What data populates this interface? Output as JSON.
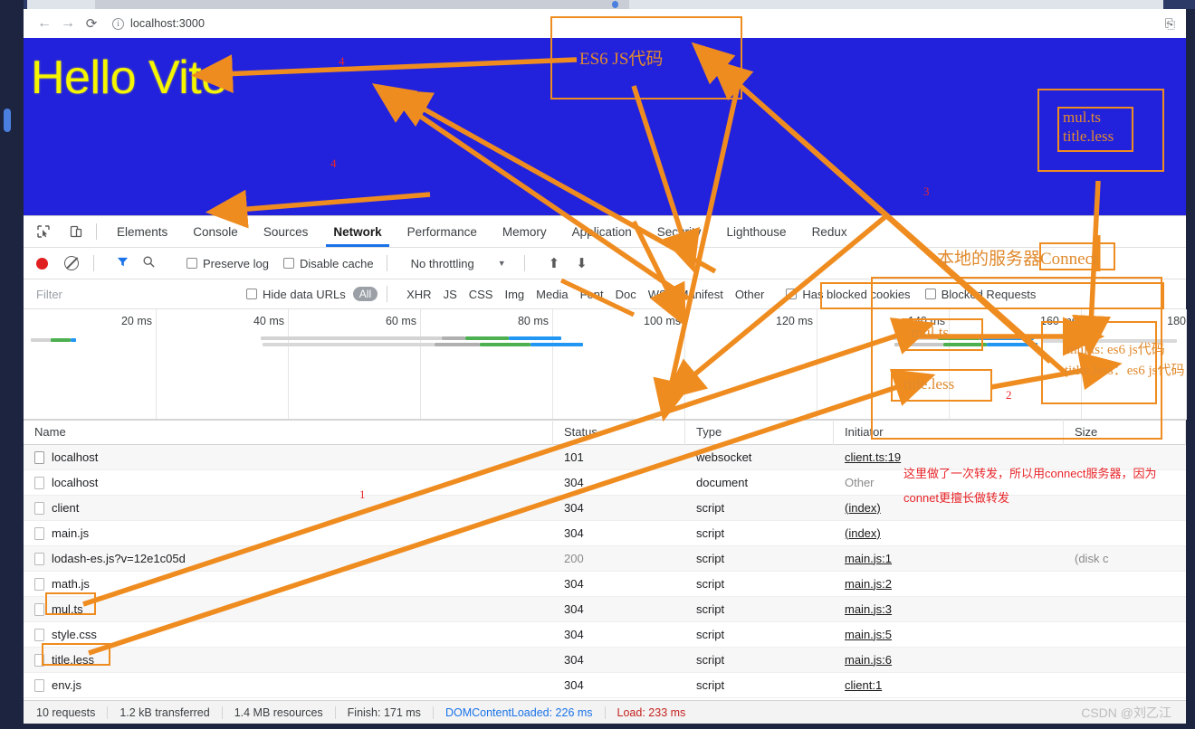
{
  "browser": {
    "back_icon": "←",
    "forward_icon": "→",
    "reload_icon": "⟳",
    "info_icon": "ⓘ",
    "url": "localhost:3000",
    "extension_icon": "⎘"
  },
  "page": {
    "heading": "Hello Vite"
  },
  "devtools": {
    "inspect_icon": "inspect-element-icon",
    "device_icon": "device-toolbar-icon",
    "tabs": [
      {
        "label": "Elements",
        "active": false
      },
      {
        "label": "Console",
        "active": false
      },
      {
        "label": "Sources",
        "active": false
      },
      {
        "label": "Network",
        "active": true
      },
      {
        "label": "Performance",
        "active": false
      },
      {
        "label": "Memory",
        "active": false
      },
      {
        "label": "Application",
        "active": false
      },
      {
        "label": "Security",
        "active": false
      },
      {
        "label": "Lighthouse",
        "active": false
      },
      {
        "label": "Redux",
        "active": false
      }
    ],
    "controls": {
      "record_label": "record-button",
      "clear_label": "clear-button",
      "filter_icon": "filter-funnel-icon",
      "search_icon": "search-icon",
      "preserve_log": "Preserve log",
      "disable_cache": "Disable cache",
      "throttling": "No throttling",
      "throttle_caret": "▼",
      "import_icon": "⬆",
      "export_icon": "⬇"
    },
    "filterbar": {
      "placeholder": "Filter",
      "hide_data_urls": "Hide data URLs",
      "types": [
        "All",
        "XHR",
        "JS",
        "CSS",
        "Img",
        "Media",
        "Font",
        "Doc",
        "WS",
        "Manifest",
        "Other"
      ],
      "has_blocked_cookies": "Has blocked cookies",
      "blocked_requests": "Blocked Requests"
    },
    "overview": {
      "ticks": [
        "20 ms",
        "40 ms",
        "60 ms",
        "80 ms",
        "100 ms",
        "120 ms",
        "140 ms",
        "160 ms",
        "180"
      ]
    },
    "table": {
      "columns": [
        "Name",
        "Status",
        "Type",
        "Initiator",
        "Size"
      ],
      "rows": [
        {
          "name": "localhost",
          "status": "101",
          "type": "websocket",
          "initiator": "client.ts:19",
          "size": ""
        },
        {
          "name": "localhost",
          "status": "304",
          "type": "document",
          "initiator": "Other",
          "size": ""
        },
        {
          "name": "client",
          "status": "304",
          "type": "script",
          "initiator": "(index)",
          "size": ""
        },
        {
          "name": "main.js",
          "status": "304",
          "type": "script",
          "initiator": "(index)",
          "size": ""
        },
        {
          "name": "lodash-es.js?v=12e1c05d",
          "status": "200",
          "type": "script",
          "initiator": "main.js:1",
          "size": "(disk c"
        },
        {
          "name": "math.js",
          "status": "304",
          "type": "script",
          "initiator": "main.js:2",
          "size": ""
        },
        {
          "name": "mul.ts",
          "status": "304",
          "type": "script",
          "initiator": "main.js:3",
          "size": ""
        },
        {
          "name": "style.css",
          "status": "304",
          "type": "script",
          "initiator": "main.js:5",
          "size": ""
        },
        {
          "name": "title.less",
          "status": "304",
          "type": "script",
          "initiator": "main.js:6",
          "size": ""
        },
        {
          "name": "env.js",
          "status": "304",
          "type": "script",
          "initiator": "client:1",
          "size": ""
        }
      ]
    },
    "statusbar": {
      "requests": "10 requests",
      "transferred": "1.2 kB transferred",
      "resources": "1.4 MB resources",
      "finish": "Finish: 171 ms",
      "dom_content_loaded": "DOMContentLoaded: 226 ms",
      "load": "Load: 233 ms",
      "watermark": "CSDN @刘乙江"
    }
  },
  "annotations": {
    "accent_color": "#ef8c20",
    "number_color": "#e8262a",
    "labels": [
      {
        "id": "es6-js-code",
        "text": "ES6 JS代码"
      },
      {
        "id": "mul-ts-box",
        "text": "mul.ts"
      },
      {
        "id": "title-less-box",
        "text": "title.less"
      },
      {
        "id": "local-server-connect",
        "text": "本地的服务器Connect"
      },
      {
        "id": "mul-ts-timeline",
        "text": "mul.ts"
      },
      {
        "id": "title-less-timeline",
        "text": "title.less"
      },
      {
        "id": "mul-ts-es6",
        "text": "mul.ts: es6 js代码"
      },
      {
        "id": "title-less-es6",
        "text": "titlte.less：es6 js代码"
      },
      {
        "id": "forward-note-line1",
        "text": "这里做了一次转发，所以用connect服务器，因为"
      },
      {
        "id": "forward-note-line2",
        "text": "connet更擅长做转发"
      }
    ],
    "numbers": [
      "1",
      "2",
      "3",
      "4",
      "4"
    ]
  },
  "waterfall": {
    "colors": {
      "queue": "#d3d3d3",
      "stalled": "#b8b8b8",
      "wait": "#4caf50",
      "download": "#2196f3"
    }
  }
}
